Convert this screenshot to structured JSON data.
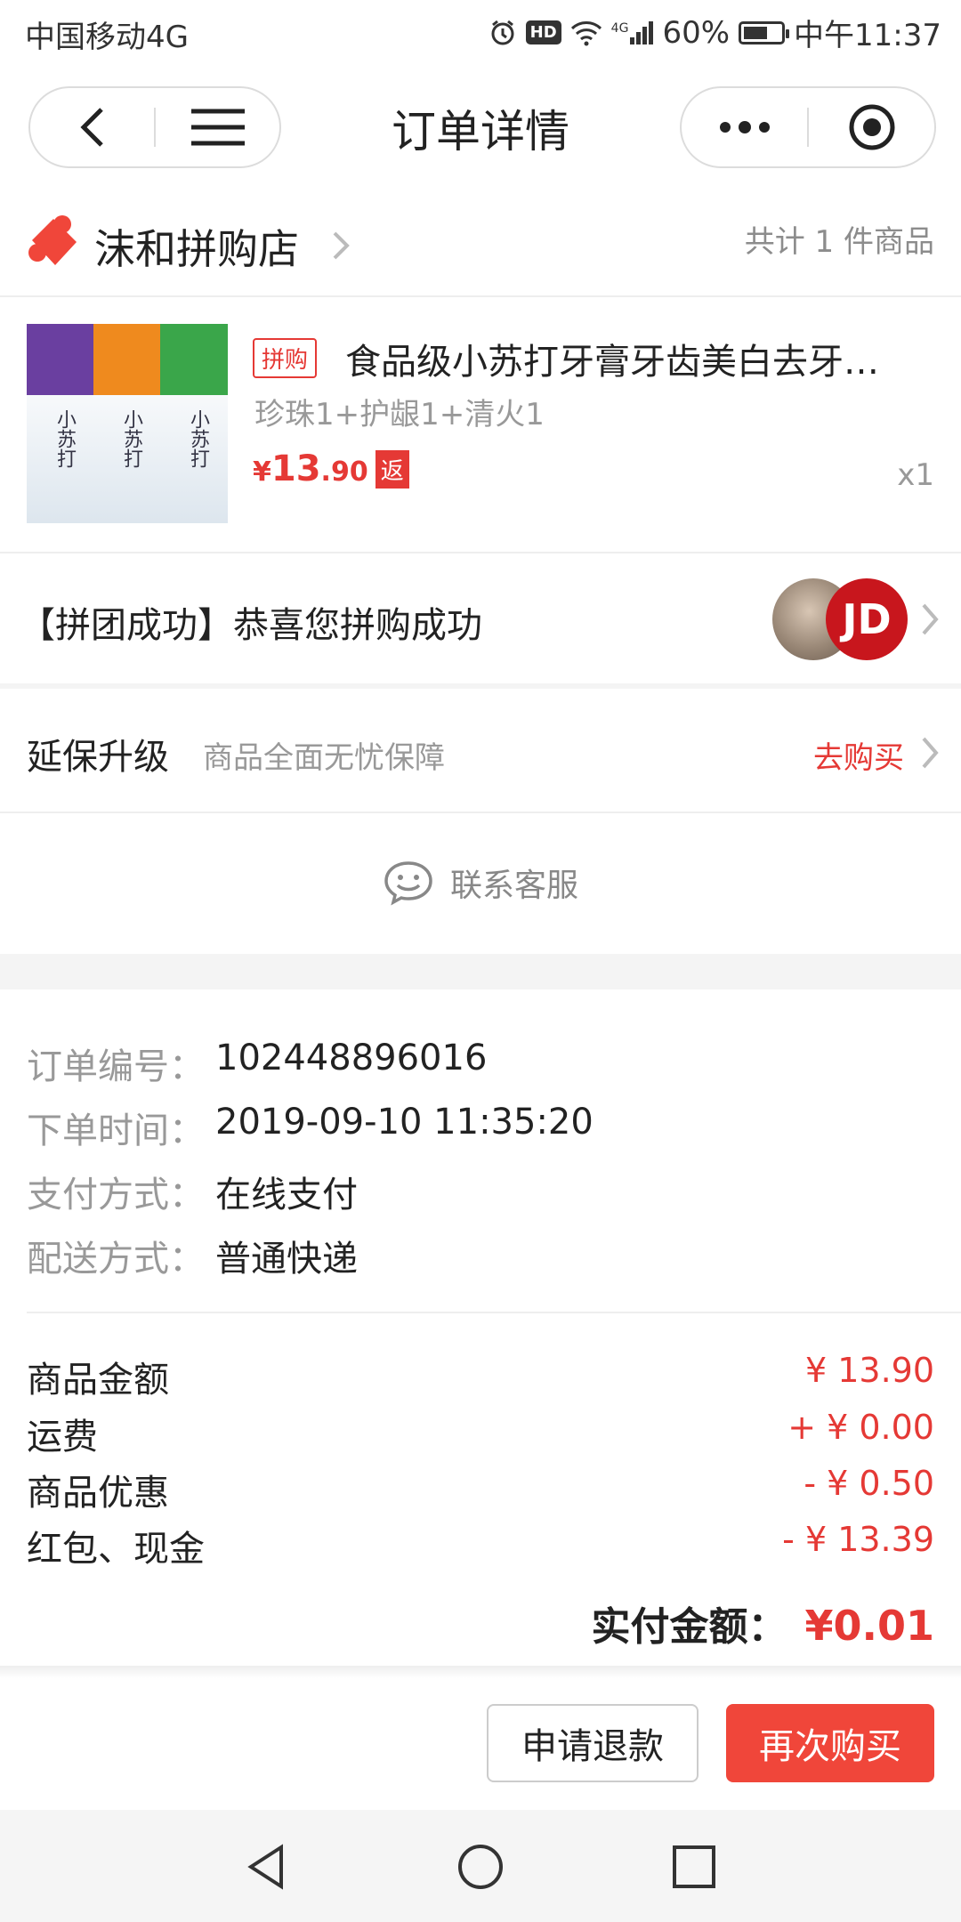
{
  "status_bar": {
    "carrier": "中国移动4G",
    "hd": "HD",
    "network": "4G",
    "battery": "60%",
    "time": "中午11:37"
  },
  "nav": {
    "title": "订单详情"
  },
  "store": {
    "name": "沫和拼购店",
    "item_count": "共计 1 件商品"
  },
  "product": {
    "tag": "拼购",
    "title": "食品级小苏打牙膏牙齿美白去牙…",
    "spec": "珍珠1+护龈1+清火1",
    "price_symbol": "¥",
    "price_int": "13",
    "price_dec": ".90",
    "rebate": "返",
    "quantity": "x1",
    "thumb_labels": [
      "小苏打",
      "小苏打",
      "小苏打"
    ],
    "thumb_colors": [
      "#6a3fa0",
      "#ef8a1e",
      "#3aa64a"
    ]
  },
  "group": {
    "text": "【拼团成功】恭喜您拼购成功",
    "avatar_2_label": "JD"
  },
  "warranty": {
    "title": "延保升级",
    "desc": "商品全面无忧保障",
    "action": "去购买"
  },
  "service": {
    "label": "联系客服"
  },
  "order": {
    "number_label": "订单编号：",
    "number": "102448896016",
    "time_label": "下单时间：",
    "time": "2019-09-10 11:35:20",
    "pay_label": "支付方式：",
    "pay": "在线支付",
    "ship_label": "配送方式：",
    "ship": "普通快递"
  },
  "amounts": {
    "goods_label": "商品金额",
    "goods": "¥ 13.90",
    "freight_label": "运费",
    "freight": "+ ¥ 0.00",
    "discount_label": "商品优惠",
    "discount": "- ¥ 0.50",
    "redpacket_label": "红包、现金",
    "redpacket": "- ¥ 13.39",
    "total_label": "实付金额：",
    "total": "¥0.01"
  },
  "actions": {
    "refund": "申请退款",
    "rebuy": "再次购买"
  },
  "colors": {
    "accent_red": "#e53935",
    "button_red": "#f0463a"
  }
}
